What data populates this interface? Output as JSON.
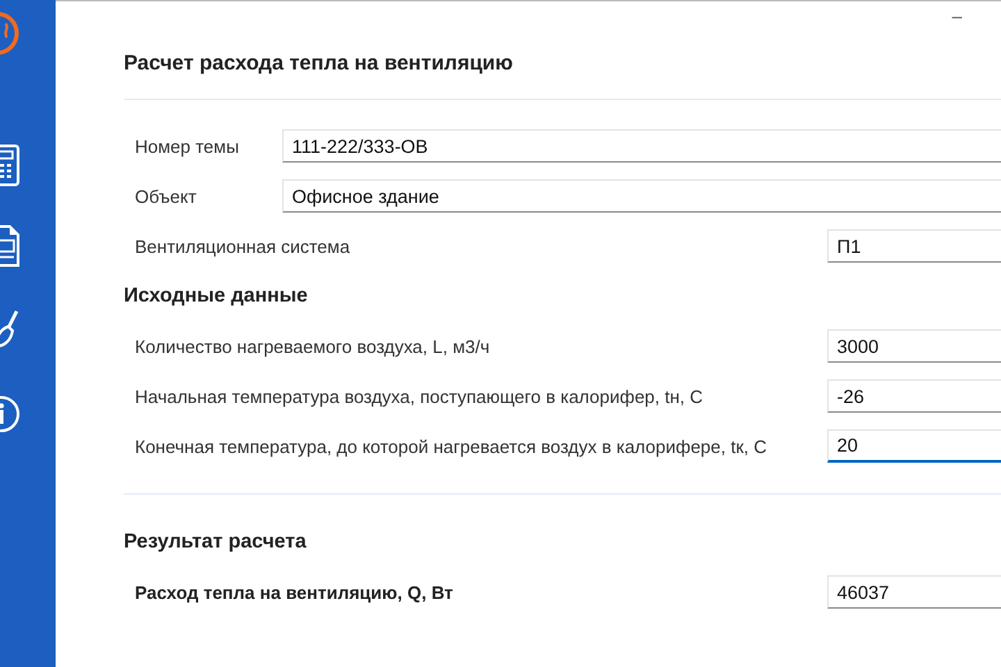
{
  "window": {
    "title": "Расчет расхода тепла на вентиляцию",
    "minimize": "–"
  },
  "header_fields": [
    {
      "label": "Номер темы",
      "value": "111-222/333-ОВ",
      "wide": true,
      "focused": false
    },
    {
      "label": "Объект",
      "value": "Офисное здание",
      "wide": true,
      "focused": false
    },
    {
      "label": "Вентиляционная система",
      "value": "П1",
      "wide": false,
      "focused": false
    }
  ],
  "input_section": {
    "title": "Исходные данные",
    "fields": [
      {
        "label": "Количество нагреваемого воздуха, L, м3/ч",
        "value": "3000",
        "focused": false
      },
      {
        "label": "Начальная температура воздуха, поступающего в калорифер, tн, С",
        "value": "-26",
        "focused": false
      },
      {
        "label": "Конечная температура, до которой нагревается воздух в калорифере, tк, С",
        "value": "20",
        "focused": true
      }
    ]
  },
  "result_section": {
    "title": "Результат расчета",
    "fields": [
      {
        "label": "Расход тепла на вентиляцию, Q, Вт",
        "value": "46037",
        "focused": false
      }
    ]
  }
}
